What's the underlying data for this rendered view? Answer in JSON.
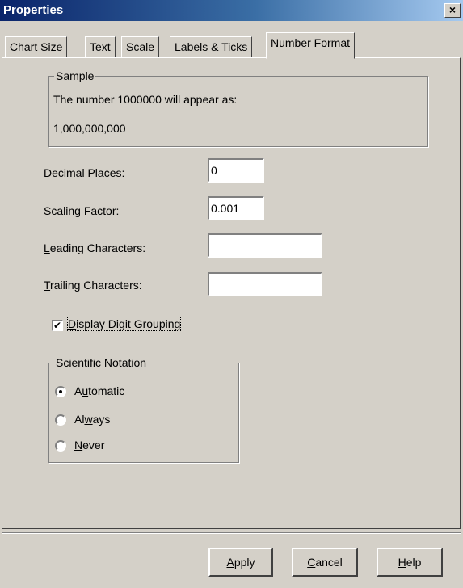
{
  "window": {
    "title": "Properties",
    "close_label": "×"
  },
  "tabs": [
    {
      "label": "Chart Size"
    },
    {
      "label": "Text"
    },
    {
      "label": "Scale"
    },
    {
      "label": "Labels & Ticks"
    },
    {
      "label": "Number Format",
      "active": true
    }
  ],
  "sample": {
    "legend": "Sample",
    "line1": "The number 1000000 will appear as:",
    "line2": "1,000,000,000"
  },
  "fields": {
    "decimal_places": {
      "accel": "D",
      "label_rest": "ecimal Places:",
      "value": "0"
    },
    "scaling_factor": {
      "accel": "S",
      "label_rest": "caling Factor:",
      "value": "0.001"
    },
    "leading_characters": {
      "accel": "L",
      "label_rest": "eading Characters:",
      "value": ""
    },
    "trailing_characters": {
      "accel": "T",
      "label_rest": "railing Characters:",
      "value": ""
    }
  },
  "digit_grouping": {
    "accel": "D",
    "label_rest": "isplay Digit Grouping",
    "checked": true,
    "check_mark": "✔"
  },
  "scientific_notation": {
    "legend": "Scientific Notation",
    "options": [
      {
        "pre": "A",
        "accel": "u",
        "post": "tomatic",
        "selected": true
      },
      {
        "pre": "Al",
        "accel": "w",
        "post": "ays",
        "selected": false
      },
      {
        "pre": "",
        "accel": "N",
        "post": "ever",
        "selected": false
      }
    ]
  },
  "buttons": {
    "apply": {
      "accel": "A",
      "rest": "pply"
    },
    "cancel": {
      "accel": "C",
      "rest": "ancel"
    },
    "help": {
      "accel": "H",
      "rest": "elp"
    }
  }
}
